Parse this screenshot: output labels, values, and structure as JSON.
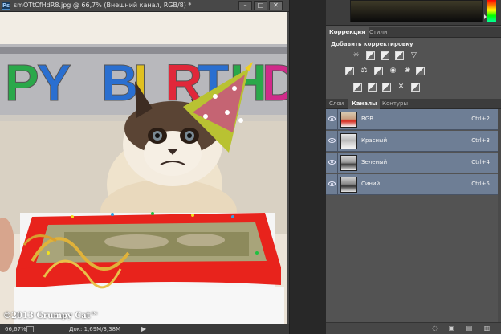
{
  "document": {
    "app_icon": "Ps",
    "title": "smOTtCfHdR8.jpg @ 66,7% (Внешний канал, RGB/8) *",
    "minimize_glyph": "–",
    "maximize_glyph": "□",
    "close_glyph": "✕",
    "image": {
      "banner_letters": [
        "P",
        "Y",
        " ",
        "B",
        "I",
        "R",
        "T",
        "H",
        "D"
      ],
      "watermark": "©2013 Grumpy Cat™"
    },
    "status": {
      "zoom": "66,67%",
      "doc_info": "Док: 1,69M/3,38M",
      "arrow": "▶"
    }
  },
  "adjustments_panel": {
    "tabs": [
      {
        "label": "Коррекция",
        "active": true
      },
      {
        "label": "Стили",
        "active": false
      }
    ],
    "heading": "Добавить корректировку"
  },
  "layers_panel": {
    "tabs": [
      {
        "label": "Слои",
        "active": false
      },
      {
        "label": "Каналы",
        "active": true
      },
      {
        "label": "Контуры",
        "active": false
      }
    ],
    "channels": [
      {
        "name": "RGB",
        "shortcut": "Ctrl+2",
        "thumb": "color"
      },
      {
        "name": "Красный",
        "shortcut": "Ctrl+3",
        "thumb": "gray-light"
      },
      {
        "name": "Зеленый",
        "shortcut": "Ctrl+4",
        "thumb": "gray"
      },
      {
        "name": "Синий",
        "shortcut": "Ctrl+5",
        "thumb": "gray-dark"
      }
    ]
  },
  "colors": {
    "selection_row": "#6e7e95",
    "panel_bg": "#535353",
    "cake_icing": "#e8231c"
  }
}
